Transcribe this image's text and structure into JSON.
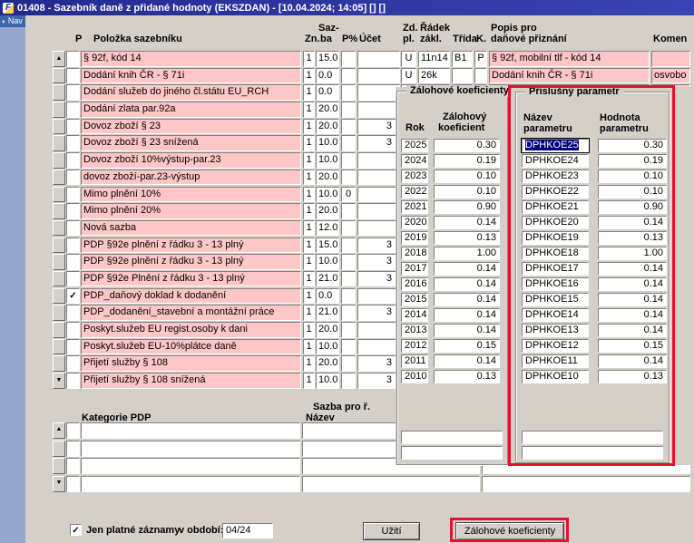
{
  "window": {
    "title": "01408 - Sazebník daně z přidané hodnoty (EKSZDAN) - [10.04.2024; 14:05] [] []",
    "app_icon": "F"
  },
  "nav": {
    "label": "Nav"
  },
  "icons": {
    "up": "▲",
    "down": "▼",
    "check": "✓",
    "nav_bullet": "◐"
  },
  "colors": {
    "row_pink": "#ffc6c6",
    "annotation_red": "#e8112d",
    "titlebar_blue": "#232a8e",
    "selection_navy": "#000080"
  },
  "main_table": {
    "headers": {
      "p": "P",
      "polozka": "Položka sazebníku",
      "zn": "Zn.",
      "saz_1": "Saz-",
      "saz_2": "ba",
      "ppct": "P%",
      "ucet": "Účet",
      "zd_1": "Zd.",
      "zd_2": "pl.",
      "radek_1": "Řádek",
      "radek_2": "zákl.",
      "trida": "Třída",
      "k": "K.",
      "popis_1": "Popis pro",
      "popis_2": "daňové přiznání",
      "koment": "Komen"
    },
    "rows": [
      {
        "checked": false,
        "polozka": "§ 92f, kód 14",
        "zn": "1",
        "sazba": "15.0",
        "ppct": "",
        "ucet": "",
        "zdpl": "U",
        "radek": "11n14",
        "trida": "B1",
        "k": "P",
        "popis": "§ 92f, mobilní tlf - kód 14",
        "koment": ""
      },
      {
        "checked": false,
        "polozka": "Dodání knih ČR - § 71i",
        "zn": "1",
        "sazba": "0.0",
        "ppct": "",
        "ucet": "",
        "zdpl": "U",
        "radek": "26k",
        "trida": "",
        "k": "",
        "popis": "Dodání knih ČR - § 71i",
        "koment": "osvobo"
      },
      {
        "checked": false,
        "polozka": "Dodání služeb do jiného čl.státu EU_RCH",
        "zn": "1",
        "sazba": "0.0",
        "ppct": "",
        "ucet": "",
        "zdpl": "",
        "radek": "",
        "trida": "",
        "k": "",
        "popis": "",
        "koment": ""
      },
      {
        "checked": false,
        "polozka": "Dodání zlata par.92a",
        "zn": "1",
        "sazba": "20.0",
        "ppct": "",
        "ucet": "",
        "zdpl": "",
        "radek": "",
        "trida": "",
        "k": "",
        "popis": "",
        "koment": ""
      },
      {
        "checked": false,
        "polozka": "Dovoz zboží § 23",
        "zn": "1",
        "sazba": "20.0",
        "ppct": "",
        "ucet": "3",
        "zdpl": "",
        "radek": "",
        "trida": "",
        "k": "",
        "popis": "",
        "koment": ""
      },
      {
        "checked": false,
        "polozka": "Dovoz zboží § 23 snížená",
        "zn": "1",
        "sazba": "10.0",
        "ppct": "",
        "ucet": "3",
        "zdpl": "",
        "radek": "",
        "trida": "",
        "k": "",
        "popis": "",
        "koment": ""
      },
      {
        "checked": false,
        "polozka": "Dovoz zboží 10%výstup-par.23",
        "zn": "1",
        "sazba": "10.0",
        "ppct": "",
        "ucet": "",
        "zdpl": "",
        "radek": "",
        "trida": "",
        "k": "",
        "popis": "",
        "koment": ""
      },
      {
        "checked": false,
        "polozka": "dovoz zboží-par.23-výstup",
        "zn": "1",
        "sazba": "20.0",
        "ppct": "",
        "ucet": "",
        "zdpl": "",
        "radek": "",
        "trida": "",
        "k": "",
        "popis": "",
        "koment": ""
      },
      {
        "checked": false,
        "polozka": "Mimo plnění 10%",
        "zn": "1",
        "sazba": "10.0",
        "ppct": "0",
        "ucet": "",
        "zdpl": "",
        "radek": "",
        "trida": "",
        "k": "",
        "popis": "",
        "koment": ""
      },
      {
        "checked": false,
        "polozka": "Mimo plnění 20%",
        "zn": "1",
        "sazba": "20.0",
        "ppct": "",
        "ucet": "",
        "zdpl": "",
        "radek": "",
        "trida": "",
        "k": "",
        "popis": "",
        "koment": ""
      },
      {
        "checked": false,
        "polozka": "Nová sazba",
        "zn": "1",
        "sazba": "12.0",
        "ppct": "",
        "ucet": "",
        "zdpl": "",
        "radek": "",
        "trida": "",
        "k": "",
        "popis": "",
        "koment": ""
      },
      {
        "checked": false,
        "polozka": "PDP §92e plnění z řádku 3 - 13 plný",
        "zn": "1",
        "sazba": "15.0",
        "ppct": "",
        "ucet": "3",
        "zdpl": "",
        "radek": "",
        "trida": "",
        "k": "",
        "popis": "",
        "koment": ""
      },
      {
        "checked": false,
        "polozka": "PDP §92e plnění z řádku 3 - 13 plný",
        "zn": "1",
        "sazba": "10.0",
        "ppct": "",
        "ucet": "3",
        "zdpl": "",
        "radek": "",
        "trida": "",
        "k": "",
        "popis": "",
        "koment": ""
      },
      {
        "checked": false,
        "polozka": "PDP §92e Plnění z řádku 3 - 13 plný",
        "zn": "1",
        "sazba": "21.0",
        "ppct": "",
        "ucet": "3",
        "zdpl": "",
        "radek": "",
        "trida": "",
        "k": "",
        "popis": "",
        "koment": ""
      },
      {
        "checked": true,
        "polozka": "PDP_daňový doklad k dodanění",
        "zn": "1",
        "sazba": "0.0",
        "ppct": "",
        "ucet": "",
        "zdpl": "",
        "radek": "",
        "trida": "",
        "k": "",
        "popis": "",
        "koment": ""
      },
      {
        "checked": false,
        "polozka": "PDP_dodanění_stavební a montážní práce",
        "zn": "1",
        "sazba": "21.0",
        "ppct": "",
        "ucet": "3",
        "zdpl": "",
        "radek": "",
        "trida": "",
        "k": "",
        "popis": "",
        "koment": ""
      },
      {
        "checked": false,
        "polozka": "Poskyt.služeb EU regist.osoby k dani",
        "zn": "1",
        "sazba": "20.0",
        "ppct": "",
        "ucet": "",
        "zdpl": "",
        "radek": "",
        "trida": "",
        "k": "",
        "popis": "",
        "koment": ""
      },
      {
        "checked": false,
        "polozka": "Poskyt.služeb EU-10%plátce daně",
        "zn": "1",
        "sazba": "10.0",
        "ppct": "",
        "ucet": "",
        "zdpl": "",
        "radek": "",
        "trida": "",
        "k": "",
        "popis": "",
        "koment": ""
      },
      {
        "checked": false,
        "polozka": "Přijetí služby § 108",
        "zn": "1",
        "sazba": "20.0",
        "ppct": "",
        "ucet": "3",
        "zdpl": "",
        "radek": "",
        "trida": "",
        "k": "",
        "popis": "",
        "koment": ""
      },
      {
        "checked": false,
        "polozka": "Přijetí služby § 108 snížená",
        "zn": "1",
        "sazba": "10.0",
        "ppct": "",
        "ucet": "3",
        "zdpl": "",
        "radek": "",
        "trida": "",
        "k": "",
        "popis": "",
        "koment": ""
      }
    ]
  },
  "koef_panel": {
    "title": "Zálohové koeficienty",
    "rok_header": "Rok",
    "koef_header_1": "Zálohový",
    "koef_header_2": "koeficient",
    "rows": [
      {
        "rok": "2025",
        "koef": "0.30"
      },
      {
        "rok": "2024",
        "koef": "0.19"
      },
      {
        "rok": "2023",
        "koef": "0.10"
      },
      {
        "rok": "2022",
        "koef": "0.10"
      },
      {
        "rok": "2021",
        "koef": "0.90"
      },
      {
        "rok": "2020",
        "koef": "0.14"
      },
      {
        "rok": "2019",
        "koef": "0.13"
      },
      {
        "rok": "2018",
        "koef": "1.00"
      },
      {
        "rok": "2017",
        "koef": "0.14"
      },
      {
        "rok": "2016",
        "koef": "0.14"
      },
      {
        "rok": "2015",
        "koef": "0.14"
      },
      {
        "rok": "2014",
        "koef": "0.14"
      },
      {
        "rok": "2013",
        "koef": "0.14"
      },
      {
        "rok": "2012",
        "koef": "0.15"
      },
      {
        "rok": "2011",
        "koef": "0.14"
      },
      {
        "rok": "2010",
        "koef": "0.13"
      }
    ]
  },
  "param_panel": {
    "title": "Příslušný parametr",
    "name_header_1": "Název",
    "name_header_2": "parametru",
    "value_header_1": "Hodnota",
    "value_header_2": "parametru",
    "rows": [
      {
        "name": "DPHKOE25",
        "value": "0.30",
        "focused": true
      },
      {
        "name": "DPHKOE24",
        "value": "0.19"
      },
      {
        "name": "DPHKOE23",
        "value": "0.10"
      },
      {
        "name": "DPHKOE22",
        "value": "0.10"
      },
      {
        "name": "DPHKOE21",
        "value": "0.90"
      },
      {
        "name": "DPHKOE20",
        "value": "0.14"
      },
      {
        "name": "DPHKOE19",
        "value": "0.13"
      },
      {
        "name": "DPHKOE18",
        "value": "1.00"
      },
      {
        "name": "DPHKOE17",
        "value": "0.14"
      },
      {
        "name": "DPHKOE16",
        "value": "0.14"
      },
      {
        "name": "DPHKOE15",
        "value": "0.14"
      },
      {
        "name": "DPHKOE14",
        "value": "0.14"
      },
      {
        "name": "DPHKOE13",
        "value": "0.14"
      },
      {
        "name": "DPHKOE12",
        "value": "0.15"
      },
      {
        "name": "DPHKOE11",
        "value": "0.14"
      },
      {
        "name": "DPHKOE10",
        "value": "0.13"
      }
    ]
  },
  "bottom_table": {
    "sazba_header": "Sazba pro ř.",
    "kategorie_header": "Kategorie PDP",
    "nazev_header": "Název",
    "rows": [
      {
        "kategorie": "",
        "nazev": "",
        "extra": ""
      },
      {
        "kategorie": "",
        "nazev": "",
        "extra": ""
      },
      {
        "kategorie": "",
        "nazev": "",
        "extra": ""
      },
      {
        "kategorie": "",
        "nazev": "",
        "extra": ""
      }
    ]
  },
  "footer": {
    "filter_checked": true,
    "filter_label": "Jen platné záznamy",
    "period_label": "v období:",
    "period_value": "04/24",
    "uziti_button": "Užití",
    "koef_button": "Zálohové koeficienty"
  }
}
